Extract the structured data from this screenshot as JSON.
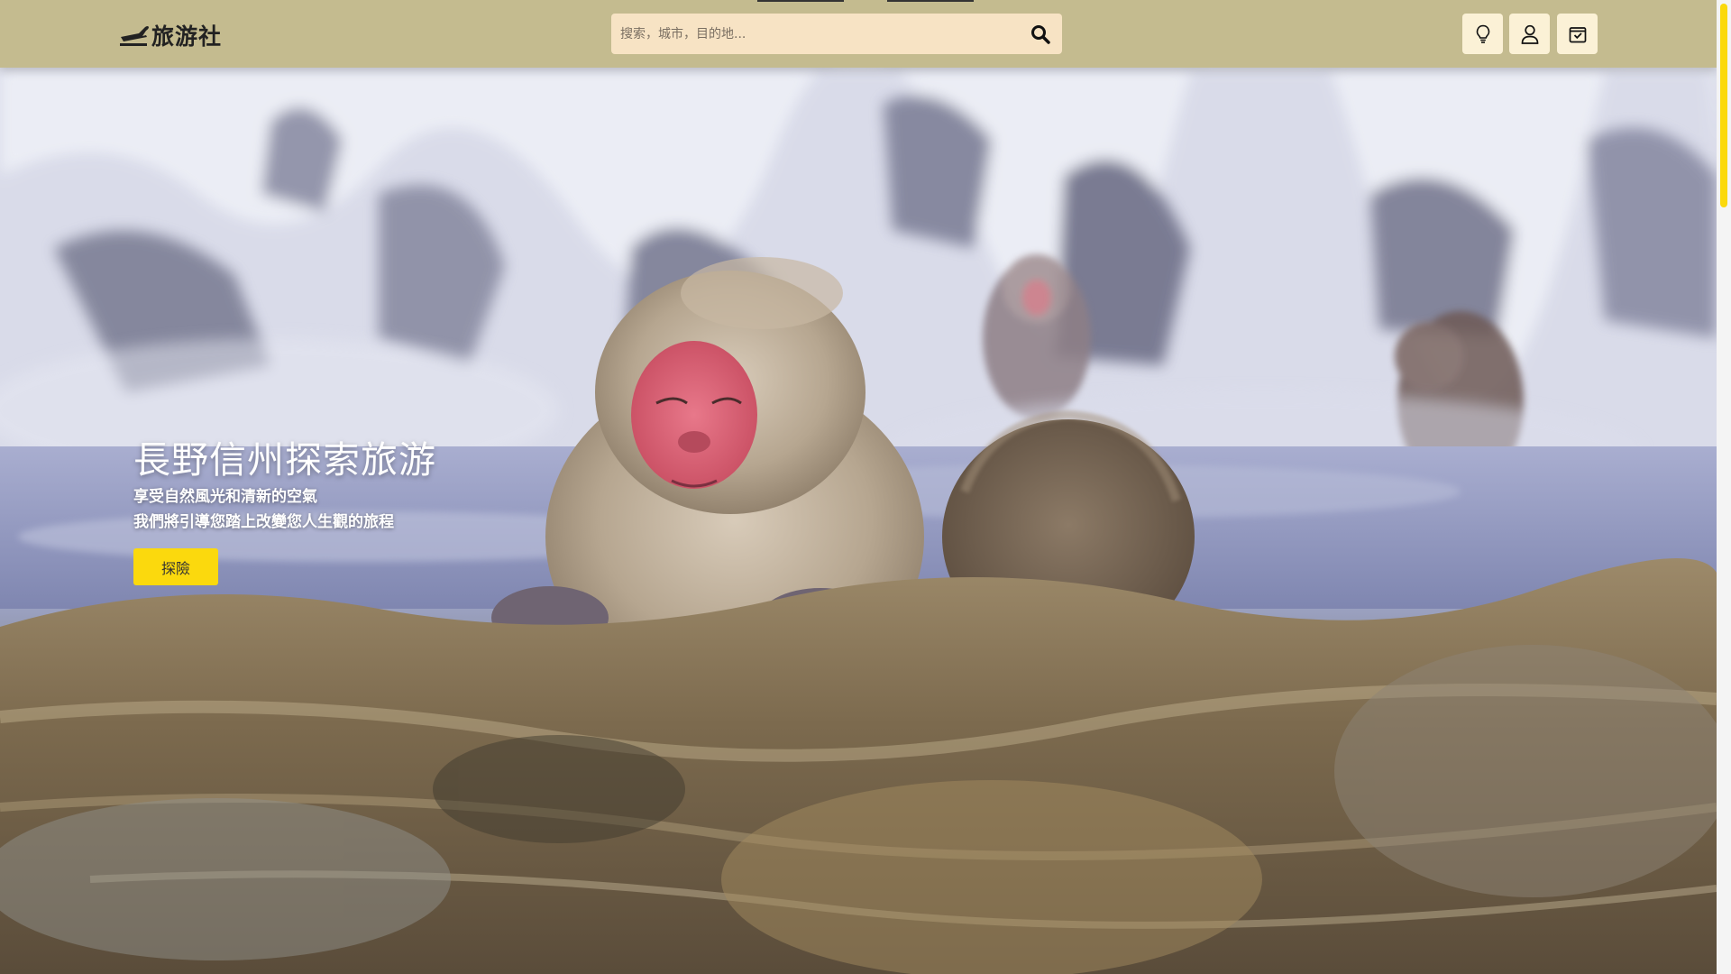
{
  "navbar": {
    "logo_text": "旅游社",
    "search_placeholder": "搜索，城市，目的地...",
    "icons": [
      "plane-logo-icon",
      "search-icon",
      "lightbulb-icon",
      "user-icon",
      "cart-check-icon"
    ]
  },
  "hero": {
    "title": "長野信州探索旅游",
    "subtitle_line1": "享受自然風光和清新的空氣",
    "subtitle_line2": "我們將引導您踏上改變您人生觀的旅程",
    "cta_label": "探險"
  },
  "colors": {
    "navbar_bg": "#c4bb8f",
    "search_bg": "#f7e3c4",
    "icon_button_bg": "#fbf1d6",
    "accent_yellow": "#fbd90d"
  }
}
